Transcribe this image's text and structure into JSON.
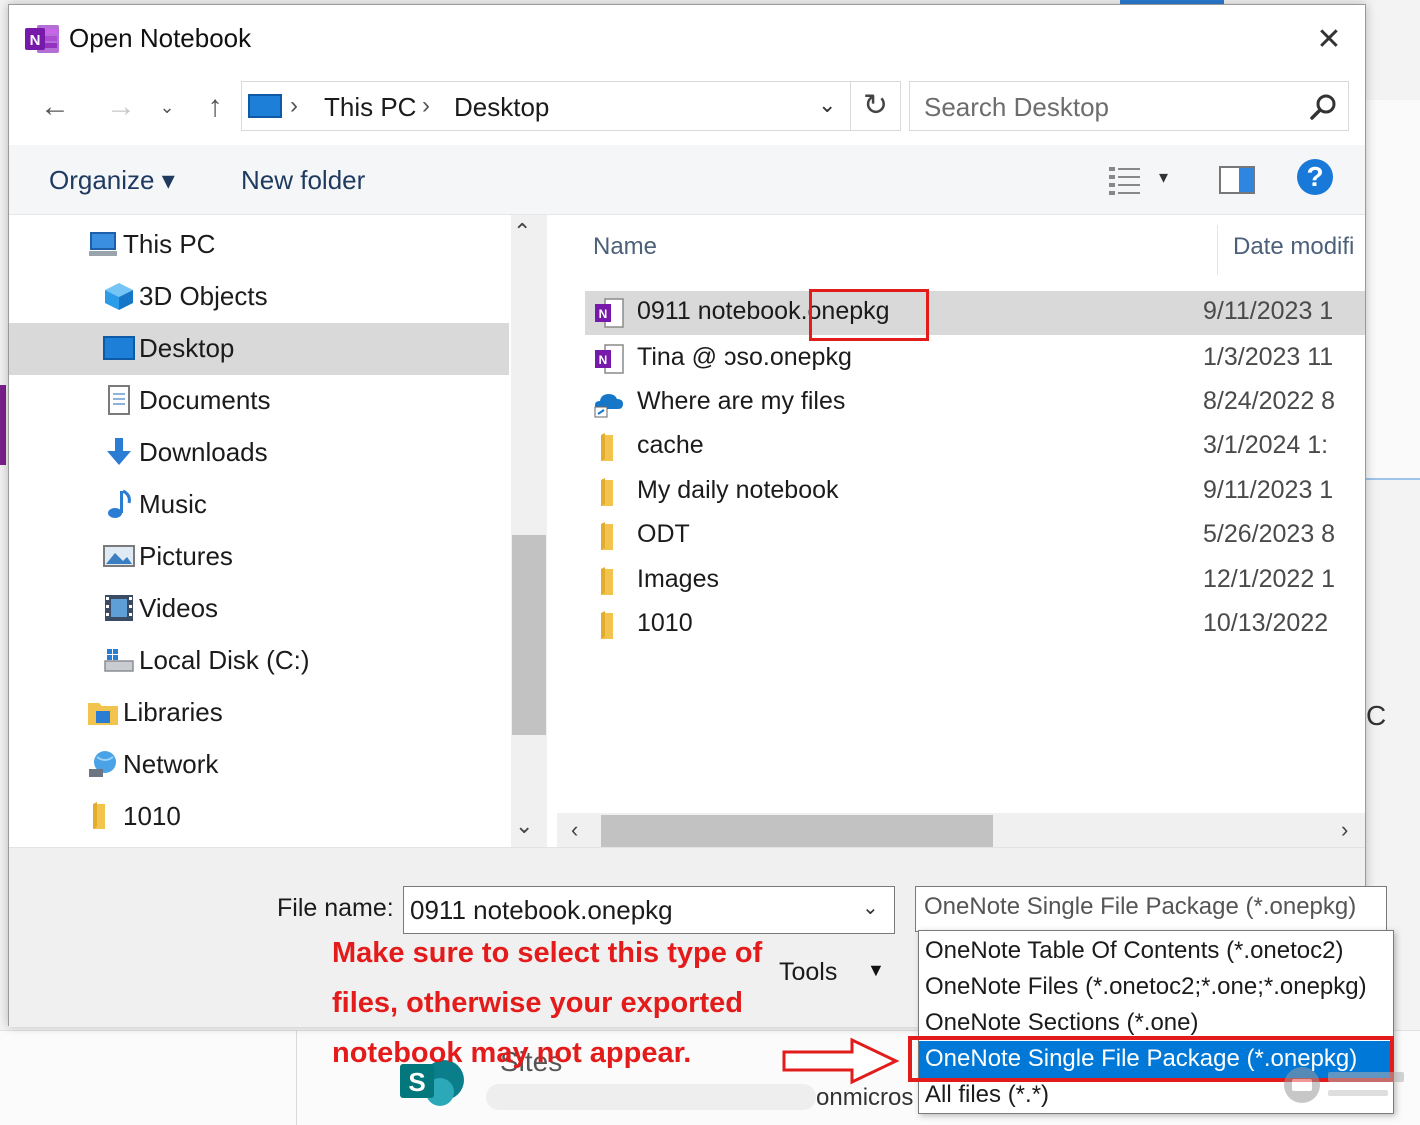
{
  "window": {
    "title": "Open Notebook",
    "close_glyph": "✕"
  },
  "nav": {
    "back_glyph": "←",
    "forward_glyph": "→",
    "recent_glyph": "⌄",
    "up_glyph": "↑"
  },
  "address": {
    "breadcrumbs": [
      "This PC",
      "Desktop"
    ],
    "separator": "›",
    "dropdown_glyph": "⌄",
    "refresh_glyph": "↻"
  },
  "search": {
    "placeholder": "Search Desktop"
  },
  "toolbar": {
    "organize_label": "Organize ▾",
    "new_folder_label": "New folder",
    "view_dd_glyph": "▾",
    "help_label": "?"
  },
  "sidebar": {
    "items": [
      {
        "label": "This PC",
        "icon": "computer-icon"
      },
      {
        "label": "3D Objects",
        "icon": "cube-icon"
      },
      {
        "label": "Desktop",
        "icon": "desktop-icon",
        "selected": true
      },
      {
        "label": "Documents",
        "icon": "document-icon"
      },
      {
        "label": "Downloads",
        "icon": "download-icon"
      },
      {
        "label": "Music",
        "icon": "music-icon"
      },
      {
        "label": "Pictures",
        "icon": "picture-icon"
      },
      {
        "label": "Videos",
        "icon": "video-icon"
      },
      {
        "label": "Local Disk (C:)",
        "icon": "disk-icon"
      },
      {
        "label": "Libraries",
        "icon": "library-icon"
      },
      {
        "label": "Network",
        "icon": "network-icon"
      },
      {
        "label": "1010",
        "icon": "folder-icon"
      }
    ],
    "scroll_up_glyph": "⌃",
    "scroll_down_glyph": "⌄"
  },
  "file_list": {
    "columns": [
      "Name",
      "Date modifi"
    ],
    "rows": [
      {
        "name": "0911 notebook.onepkg",
        "date": "9/11/2023 1",
        "icon": "onenote-file-icon",
        "selected": true
      },
      {
        "name": "Tina @            ɔso.onepkg",
        "date": "1/3/2023 11",
        "icon": "onenote-file-icon"
      },
      {
        "name": "Where are my files",
        "date": "8/24/2022 8",
        "icon": "onedrive-shortcut-icon"
      },
      {
        "name": "cache",
        "date": "3/1/2024 1:",
        "icon": "folder-icon"
      },
      {
        "name": "My daily notebook",
        "date": "9/11/2023 1",
        "icon": "folder-icon"
      },
      {
        "name": "ODT",
        "date": "5/26/2023 8",
        "icon": "folder-icon"
      },
      {
        "name": "Images",
        "date": "12/1/2022 1",
        "icon": "folder-icon"
      },
      {
        "name": "1010",
        "date": "10/13/2022",
        "icon": "folder-icon"
      }
    ],
    "hscroll_left_glyph": "‹",
    "hscroll_right_glyph": "›"
  },
  "bottom": {
    "file_name_label": "File name:",
    "file_name_value": "0911 notebook.onepkg",
    "file_name_dd_glyph": "⌄",
    "file_type_value": "OneNote Single File Package (*.onepkg)",
    "tools_label": "Tools",
    "tools_dd_glyph": "▼"
  },
  "file_type_options": [
    "OneNote Table Of Contents (*.onetoc2)",
    "OneNote Files (*.onetoc2;*.one;*.onepkg)",
    "OneNote Sections (*.one)",
    "OneNote Single File Package (*.onepkg)",
    "All files (*.*)"
  ],
  "selected_option_index": 3,
  "annotation": {
    "text": "Make sure to select this type of files, otherwise your exported notebook may not appear.",
    "color": "#e31b1b"
  },
  "background": {
    "sites_label": "Sites",
    "tenant_label": "onmicros",
    "side_letter": "C"
  },
  "colors": {
    "accent": "#0078d7",
    "highlight": "#e21b1b",
    "onenote": "#7719aa"
  }
}
